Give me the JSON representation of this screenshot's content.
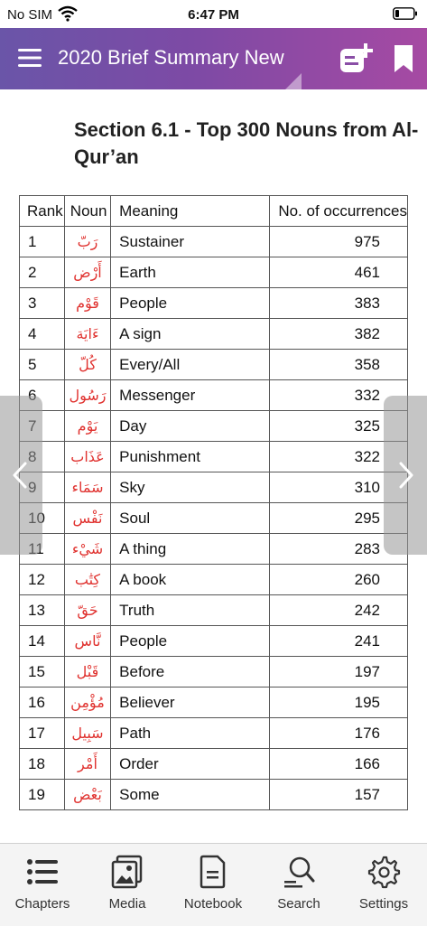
{
  "status_bar": {
    "carrier": "No SIM",
    "time": "6:47 PM"
  },
  "header": {
    "title": "2020 Brief Summary New"
  },
  "section": {
    "title": "Section 6.1 - Top 300 Nouns from Al-Qur’an"
  },
  "table": {
    "headers": {
      "rank": "Rank",
      "noun": "Noun",
      "meaning": "Meaning",
      "count": "No. of occurrences"
    },
    "rows": [
      {
        "rank": "1",
        "noun": "رَبّ",
        "meaning": "Sustainer",
        "count": "975"
      },
      {
        "rank": "2",
        "noun": "أَرْض",
        "meaning": "Earth",
        "count": "461"
      },
      {
        "rank": "3",
        "noun": "قَوْم",
        "meaning": "People",
        "count": "383"
      },
      {
        "rank": "4",
        "noun": "ءَايَة",
        "meaning": "A sign",
        "count": "382"
      },
      {
        "rank": "5",
        "noun": "كُلّ",
        "meaning": "Every/All",
        "count": "358"
      },
      {
        "rank": "6",
        "noun": "رَسُول",
        "meaning": "Messenger",
        "count": "332"
      },
      {
        "rank": "7",
        "noun": "يَوْم",
        "meaning": "Day",
        "count": "325"
      },
      {
        "rank": "8",
        "noun": "عَذَاب",
        "meaning": "Punishment",
        "count": "322"
      },
      {
        "rank": "9",
        "noun": "سَمَاء",
        "meaning": "Sky",
        "count": "310"
      },
      {
        "rank": "10",
        "noun": "نَفْس",
        "meaning": "Soul",
        "count": "295"
      },
      {
        "rank": "11",
        "noun": "شَيْء",
        "meaning": "A thing",
        "count": "283"
      },
      {
        "rank": "12",
        "noun": "كِتَٰب",
        "meaning": "A book",
        "count": "260"
      },
      {
        "rank": "13",
        "noun": "حَقّ",
        "meaning": "Truth",
        "count": "242"
      },
      {
        "rank": "14",
        "noun": "نَّاس",
        "meaning": "People",
        "count": "241"
      },
      {
        "rank": "15",
        "noun": "قَبْل",
        "meaning": "Before",
        "count": "197"
      },
      {
        "rank": "16",
        "noun": "مُؤْمِن",
        "meaning": "Believer",
        "count": "195"
      },
      {
        "rank": "17",
        "noun": "سَبِيل",
        "meaning": "Path",
        "count": "176"
      },
      {
        "rank": "18",
        "noun": "أَمْر",
        "meaning": "Order",
        "count": "166"
      },
      {
        "rank": "19",
        "noun": "بَعْض",
        "meaning": "Some",
        "count": "157"
      }
    ]
  },
  "tabs": {
    "chapters": "Chapters",
    "media": "Media",
    "notebook": "Notebook",
    "search": "Search",
    "settings": "Settings"
  },
  "icons": {
    "status": [
      "wifi-icon",
      "battery-icon"
    ],
    "header": [
      "menu-icon",
      "add-note-icon",
      "bookmark-icon"
    ],
    "nav": [
      "chevron-left-icon",
      "chevron-right-icon"
    ],
    "tabs": [
      "list-icon",
      "photos-icon",
      "document-icon",
      "search-icon",
      "gear-icon"
    ]
  },
  "colors": {
    "header_start": "#6a55a8",
    "header_end": "#a64aa3",
    "arabic_text": "#e0322f"
  }
}
